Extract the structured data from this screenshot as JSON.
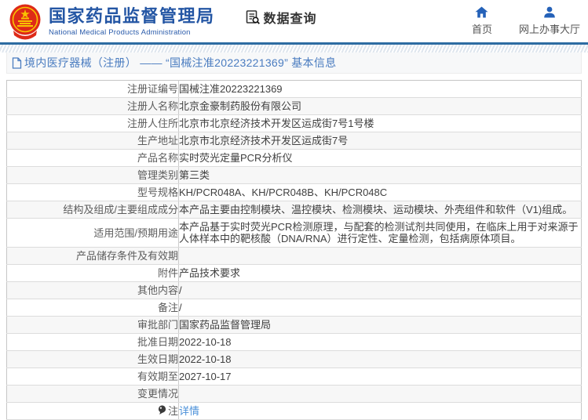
{
  "header": {
    "logo": {
      "emblem_icon": "national-emblem-icon",
      "title_cn": "国家药品监督管理局",
      "title_en": "National Medical Products Administration"
    },
    "data_query": {
      "icon": "document-search-icon",
      "label": "数据查询"
    },
    "nav": [
      {
        "icon": "home-icon",
        "label": "首页"
      },
      {
        "icon": "user-icon",
        "label": "网上办事大厅"
      }
    ]
  },
  "breadcrumb": {
    "icon": "document-icon",
    "text": "境内医疗器械（注册） —— “国械注准20223221369” 基本信息"
  },
  "table": {
    "rows": [
      {
        "label": "注册证编号",
        "value": "国械注准20223221369"
      },
      {
        "label": "注册人名称",
        "value": "北京金豪制药股份有限公司"
      },
      {
        "label": "注册人住所",
        "value": "北京市北京经济技术开发区运成街7号1号楼"
      },
      {
        "label": "生产地址",
        "value": "北京市北京经济技术开发区运成街7号"
      },
      {
        "label": "产品名称",
        "value": "实时荧光定量PCR分析仪"
      },
      {
        "label": "管理类别",
        "value": "第三类"
      },
      {
        "label": "型号规格",
        "value": "KH/PCR048A、KH/PCR048B、KH/PCR048C"
      },
      {
        "label": "结构及组成/主要组成成分",
        "value": "本产品主要由控制模块、温控模块、检测模块、运动模块、外壳组件和软件（V1)组成。"
      },
      {
        "label": "适用范围/预期用途",
        "value": "本产品基于实时荧光PCR检测原理，与配套的检测试剂共同使用，在临床上用于对来源于人体样本中的靶核酸（DNA/RNA）进行定性、定量检测，包括病原体项目。"
      },
      {
        "label": "产品储存条件及有效期",
        "value": ""
      },
      {
        "label": "附件",
        "value": "产品技术要求"
      },
      {
        "label": "其他内容",
        "value": "/"
      },
      {
        "label": "备注",
        "value": "/"
      },
      {
        "label": "审批部门",
        "value": "国家药品监督管理局"
      },
      {
        "label": "批准日期",
        "value": "2022-10-18"
      },
      {
        "label": "生效日期",
        "value": "2022-10-18"
      },
      {
        "label": "有效期至",
        "value": "2027-10-17"
      },
      {
        "label": "变更情况",
        "value": ""
      },
      {
        "label": "注",
        "value": "详情",
        "value_is_link": true,
        "label_icon": "note-bulb-icon"
      }
    ]
  },
  "colors": {
    "brand_blue": "#2456a4",
    "nav_icon_blue": "#2461b8",
    "divider_blue": "#2d6ca2",
    "breadcrumb_blue": "#4a7cc0",
    "link_blue": "#4a90d9",
    "row_alt_bg": "#f7f7f7",
    "emblem_red": "#de2a18",
    "emblem_gold": "#f8c301"
  }
}
